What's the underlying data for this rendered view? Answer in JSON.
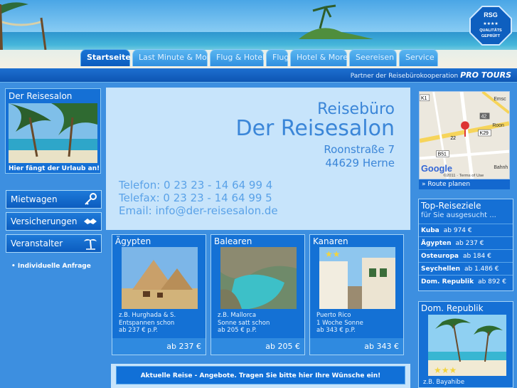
{
  "nav": {
    "tabs": [
      {
        "label": "Startseite",
        "active": true
      },
      {
        "label": "Last Minute & More"
      },
      {
        "label": "Flug & Hotel"
      },
      {
        "label": "Flug"
      },
      {
        "label": "Hotel & More"
      },
      {
        "label": "Seereisen"
      },
      {
        "label": "Service"
      }
    ]
  },
  "badge": {
    "top": "RSG",
    "stars": "★★★★",
    "line1": "QUALITÄTS",
    "line2": "GEPRÜFT"
  },
  "subbar": {
    "text": "Partner der Reisebürokooperation",
    "brand": "PRO TOURS"
  },
  "sidebar": {
    "promo_title": "Der Reisesalon",
    "promo_caption": "Hier fängt der Urlaub an!",
    "menu": [
      {
        "label": "Mietwagen",
        "icon": "keys-icon"
      },
      {
        "label": "Versicherungen",
        "icon": "handshake-icon"
      },
      {
        "label": "Veranstalter",
        "icon": "palm-icon"
      }
    ],
    "link": "• Individuelle Anfrage"
  },
  "contact": {
    "title1": "Reisebüro",
    "title2": "Der Reisesalon",
    "street": "Roonstraße 7",
    "city": "44629 Herne",
    "phone": "Telefon: 0 23 23 - 14 64 99 4",
    "fax": "Telefax: 0 23 23 - 14 64 99 5",
    "email": "Email: info@der-reisesalon.de"
  },
  "destinations": [
    {
      "title": "Ägypten",
      "desc1": "z.B. Hurghada & S.",
      "desc2": "Entspannen schon",
      "desc3": "ab 237 € p.P.",
      "price": "ab 237 €"
    },
    {
      "title": "Balearen",
      "desc1": "z.B. Mallorca",
      "desc2": "Sonne satt schon",
      "desc3": "ab 205 € p.P.",
      "price": "ab 205 €"
    },
    {
      "title": "Kanaren",
      "desc1": "Puerto Rico",
      "desc2": "1 Woche Sonne",
      "desc3": "ab 343 € p.P.",
      "price": "ab 343 €"
    }
  ],
  "anfrage": {
    "label": "Aktuelle Reise - Angebote. Tragen Sie bitte hier Ihre Wünsche ein!"
  },
  "map": {
    "route": "» Route planen",
    "labels": {
      "k1": "K1",
      "n42": "42",
      "k29": "K29",
      "n22": "22",
      "b51": "B51",
      "emsc": "Emsc",
      "roon": "Roon",
      "google": "Google",
      "copy": "©2011 · Terms of Use",
      "bahn": "Bahnh"
    }
  },
  "top": {
    "title": "Top-Reiseziele",
    "sub": "für Sie ausgesucht ...",
    "rows": [
      {
        "name": "Kuba",
        "price": "ab 974 €"
      },
      {
        "name": "Ägypten",
        "price": "ab 237 €"
      },
      {
        "name": "Osteuropa",
        "price": "ab 184 €"
      },
      {
        "name": "Seychellen",
        "price": "ab 1.486 €"
      },
      {
        "name": "Dom. Republik",
        "price": "ab 892 €"
      }
    ]
  },
  "dr": {
    "title": "Dom. Republik",
    "desc": "z.B. Bayahibe"
  }
}
